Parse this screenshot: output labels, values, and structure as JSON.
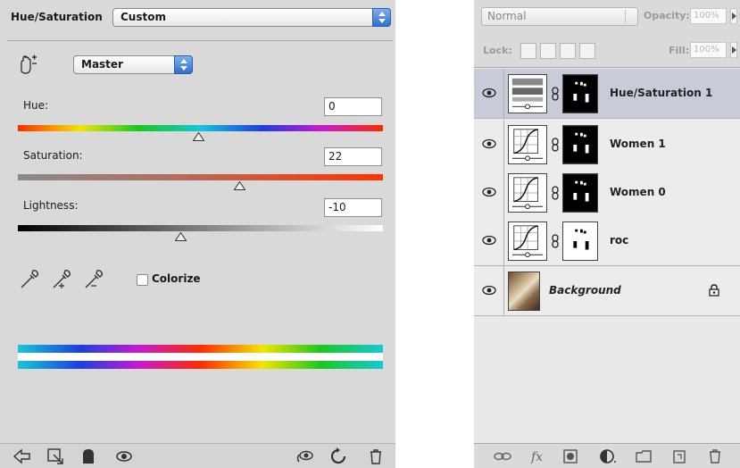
{
  "hue_saturation": {
    "title": "Hue/Saturation",
    "preset": "Custom",
    "channel": "Master",
    "hue": {
      "label": "Hue:",
      "value": "0",
      "slider_fraction": 0.5
    },
    "saturation": {
      "label": "Saturation:",
      "value": "22",
      "slider_fraction": 0.61
    },
    "lightness": {
      "label": "Lightness:",
      "value": "-10",
      "slider_fraction": 0.45
    },
    "colorize": {
      "label": "Colorize",
      "checked": false
    },
    "eyedroppers": [
      "eyedropper-icon",
      "eyedropper-plus-icon",
      "eyedropper-minus-icon"
    ],
    "bottom_icons": [
      "clip-to-layer-icon",
      "layer-visibility-toggle-icon",
      "view-previous-icon",
      "reset-icon",
      "trash-icon"
    ]
  },
  "layers": {
    "blend_mode": "Normal",
    "opacity_label": "Opacity:",
    "opacity_value": "100%",
    "lock_label": "Lock:",
    "fill_label": "Fill:",
    "fill_value": "100%",
    "rows": [
      {
        "name": "Hue/Saturation 1",
        "selected": true,
        "type": "hue-saturation-adjustment"
      },
      {
        "name": "Women 1",
        "selected": false,
        "type": "curves-adjustment"
      },
      {
        "name": "Women 0",
        "selected": false,
        "type": "curves-adjustment"
      },
      {
        "name": "roc",
        "selected": false,
        "type": "curves-adjustment"
      },
      {
        "name": "Background",
        "selected": false,
        "type": "image",
        "locked": true
      }
    ],
    "bottom_icons": [
      "link-layers-icon",
      "fx-icon",
      "add-mask-icon",
      "new-adjustment-icon",
      "new-group-icon",
      "new-layer-icon",
      "trash-icon"
    ]
  },
  "colors": {
    "panel_bg": "#d9d9d9",
    "selected_row": "#c8ccd8",
    "accent_blue": "#2f6fd0"
  }
}
